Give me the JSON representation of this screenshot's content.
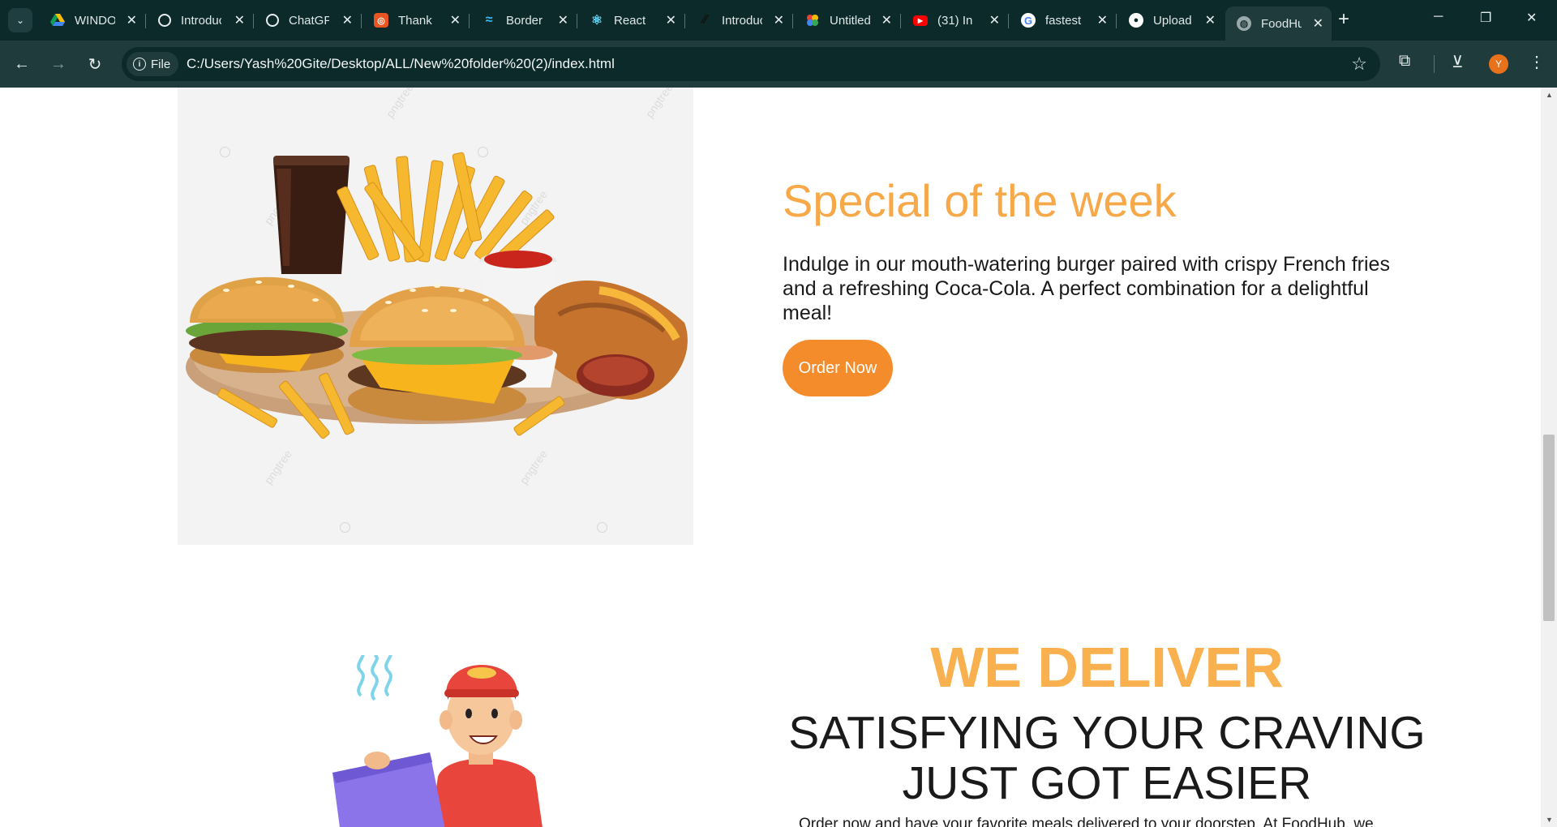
{
  "browser": {
    "tabs": [
      {
        "title": "WINDOWS",
        "icon": "google-drive-icon",
        "color": "#4285f4"
      },
      {
        "title": "Introducing",
        "icon": "openai-icon",
        "color": "#ffffff"
      },
      {
        "title": "ChatGPT",
        "icon": "openai-icon",
        "color": "#ffffff"
      },
      {
        "title": "Thank",
        "icon": "ubuntu-icon",
        "color": "#e95420"
      },
      {
        "title": "Border",
        "icon": "tailwind-icon",
        "color": "#38bdf8"
      },
      {
        "title": "React",
        "icon": "react-icon",
        "color": "#61dafb"
      },
      {
        "title": "Introducing",
        "icon": "slash-icon",
        "color": "#111111"
      },
      {
        "title": "Untitled",
        "icon": "google-photos-icon",
        "color": "#fbbc04"
      },
      {
        "title": "(31) In",
        "icon": "youtube-icon",
        "color": "#ff0000"
      },
      {
        "title": "fastest",
        "icon": "google-icon",
        "color": "#ffffff"
      },
      {
        "title": "Upload",
        "icon": "github-icon",
        "color": "#ffffff"
      },
      {
        "title": "FoodHub",
        "icon": "globe-icon",
        "color": "#9aa9a9",
        "active": true
      }
    ],
    "url_chip": "File",
    "url": "C:/Users/Yash%20Gite/Desktop/ALL/New%20folder%20(2)/index.html",
    "profile_initial": "Y"
  },
  "special": {
    "title": "Special of the week",
    "description": "Indulge in our mouth-watering burger paired with crispy French fries and a refreshing Coca-Cola. A perfect combination for a delightful meal!",
    "button": "Order Now",
    "image_watermark": "pngtree"
  },
  "delivery": {
    "title": "WE DELIVER",
    "subtitle_line1": "SATISFYING YOUR CRAVING",
    "subtitle_line2": "JUST GOT EASIER",
    "text": "Order now and have your favorite meals delivered to your doorstep. At FoodHub, we"
  },
  "colors": {
    "accent": "#f7a94a",
    "button": "#f48c2b",
    "chrome_dark": "#0d2a2b",
    "chrome_toolbar": "#1f3b3c"
  }
}
